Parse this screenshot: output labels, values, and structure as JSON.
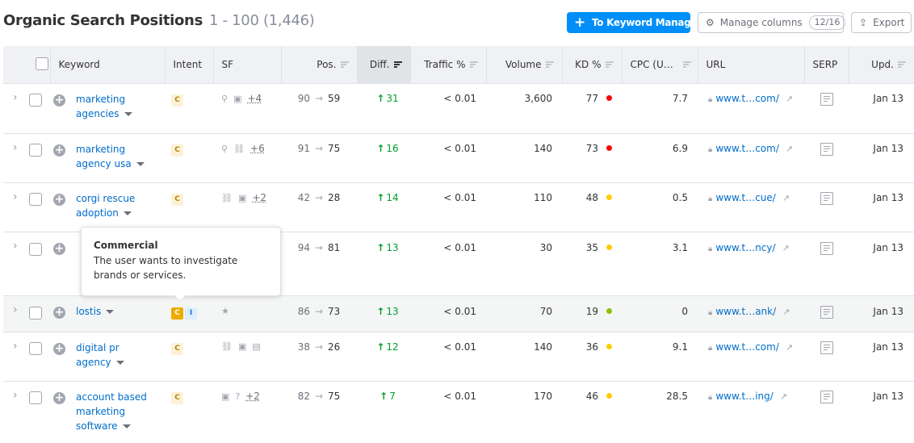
{
  "header": {
    "title": "Organic Search Positions",
    "range": "1 - 100 (1,446)",
    "to_keyword_manager": "To Keyword Manager",
    "manage_columns": "Manage columns",
    "columns_count": "12/16",
    "export": "Export"
  },
  "columns": {
    "keyword": "Keyword",
    "intent": "Intent",
    "sf": "SF",
    "pos": "Pos.",
    "diff": "Diff.",
    "traffic": "Traffic %",
    "volume": "Volume",
    "kd": "KD %",
    "cpc": "CPC (U…",
    "url": "URL",
    "serp": "SERP",
    "upd": "Upd."
  },
  "colors": {
    "kd_hard": "#ff0000",
    "kd_medium": "#ffcc00",
    "kd_easy": "#8bc20f",
    "diff_up": "#009f2a",
    "link": "#006dca",
    "primary": "#008ff8"
  },
  "rows": [
    {
      "keyword": "marketing agencies",
      "intent": [
        "C"
      ],
      "sf": [
        "location-pin-icon",
        "faq-icon"
      ],
      "sf_more": "+4",
      "pos_from": "90",
      "pos_to": "59",
      "diff": "31",
      "traffic": "< 0.01",
      "volume": "3,600",
      "kd": "77",
      "kd_level": "hard",
      "cpc": "7.7",
      "url": "www.t…com/",
      "upd": "Jan 13"
    },
    {
      "keyword": "marketing agency usa",
      "intent": [
        "C"
      ],
      "sf": [
        "location-pin-icon",
        "link-icon"
      ],
      "sf_more": "+6",
      "pos_from": "91",
      "pos_to": "75",
      "diff": "16",
      "traffic": "< 0.01",
      "volume": "140",
      "kd": "73",
      "kd_level": "hard",
      "cpc": "6.9",
      "url": "www.t…com/",
      "upd": "Jan 13"
    },
    {
      "keyword": "corgi rescue adoption",
      "intent": [
        "C"
      ],
      "sf": [
        "link-icon",
        "faq-icon"
      ],
      "sf_more": "+2",
      "pos_from": "42",
      "pos_to": "28",
      "diff": "14",
      "traffic": "< 0.01",
      "volume": "110",
      "kd": "48",
      "kd_level": "medium",
      "cpc": "0.5",
      "url": "www.t…cue/",
      "upd": "Jan 13"
    },
    {
      "keyword": "",
      "intent": [],
      "sf": [],
      "sf_more": "",
      "pos_from": "94",
      "pos_to": "81",
      "diff": "13",
      "traffic": "< 0.01",
      "volume": "30",
      "kd": "35",
      "kd_level": "medium",
      "cpc": "3.1",
      "url": "www.t…ncy/",
      "upd": "Jan 13"
    },
    {
      "keyword": "lostis",
      "intent": [
        "C",
        "I"
      ],
      "sf": [
        "star-icon"
      ],
      "sf_more": "",
      "pos_from": "86",
      "pos_to": "73",
      "diff": "13",
      "traffic": "< 0.01",
      "volume": "70",
      "kd": "19",
      "kd_level": "easy",
      "cpc": "0",
      "url": "www.t…ank/",
      "upd": "Jan 13"
    },
    {
      "keyword": "digital pr agency",
      "intent": [
        "C"
      ],
      "sf": [
        "link-icon",
        "faq-icon",
        "ad-icon"
      ],
      "sf_more": "",
      "pos_from": "38",
      "pos_to": "26",
      "diff": "12",
      "traffic": "< 0.01",
      "volume": "140",
      "kd": "36",
      "kd_level": "medium",
      "cpc": "9.1",
      "url": "www.t…com/",
      "upd": "Jan 13"
    },
    {
      "keyword": "account based marketing software",
      "intent": [
        "C"
      ],
      "sf": [
        "faq-icon",
        "question-icon"
      ],
      "sf_more": "+2",
      "pos_from": "82",
      "pos_to": "75",
      "diff": "7",
      "traffic": "< 0.01",
      "volume": "170",
      "kd": "46",
      "kd_level": "medium",
      "cpc": "28.5",
      "url": "www.t…ing/",
      "upd": "Jan 13"
    }
  ],
  "tooltip": {
    "title": "Commercial",
    "body": "The user wants to investigate brands or services."
  }
}
